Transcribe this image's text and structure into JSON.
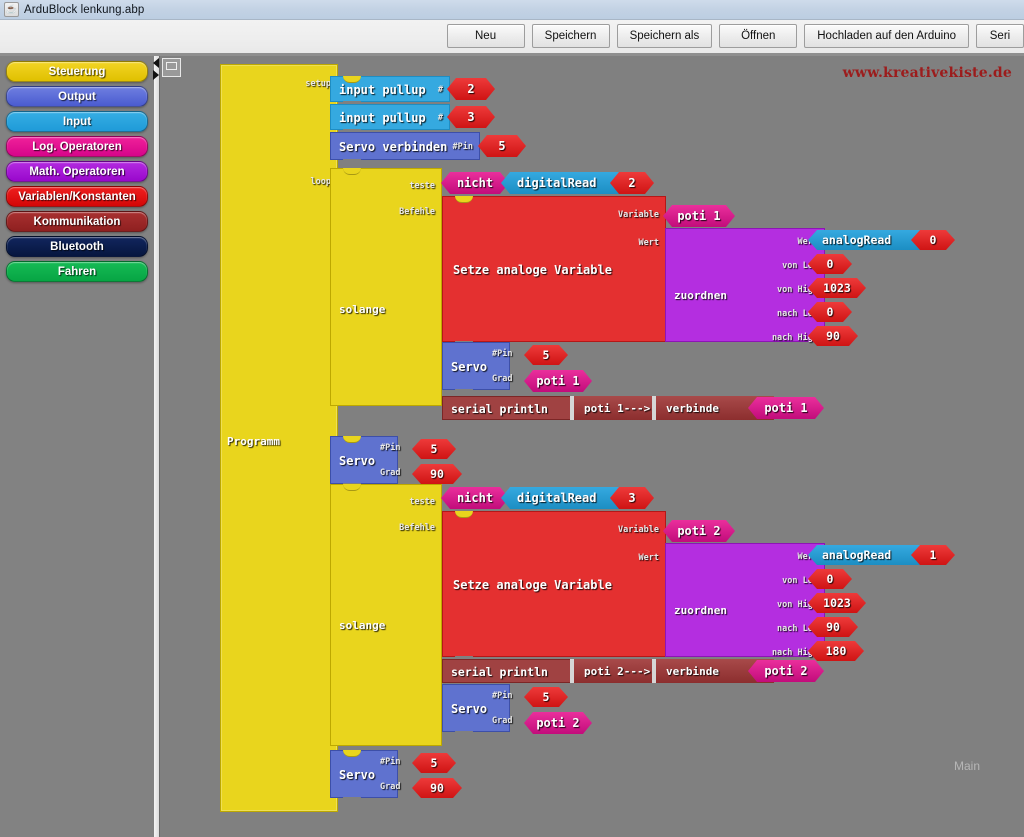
{
  "window": {
    "title": "ArduBlock lenkung.abp",
    "icon": "java-coffee-cup-icon"
  },
  "toolbar": {
    "buttons": [
      {
        "label": "Neu",
        "name": "new-button"
      },
      {
        "label": "Speichern",
        "name": "save-button"
      },
      {
        "label": "Speichern als",
        "name": "save-as-button"
      },
      {
        "label": "Öffnen",
        "name": "open-button"
      },
      {
        "label": "Hochladen auf den Arduino",
        "name": "upload-button"
      },
      {
        "label": "Seri",
        "name": "serial-monitor-button"
      }
    ]
  },
  "palette": {
    "categories": [
      {
        "label": "Steuerung",
        "color": "#e9d51d"
      },
      {
        "label": "Output",
        "color": "#4a5bd0"
      },
      {
        "label": "Input",
        "color": "#1f9bd8"
      },
      {
        "label": "Log. Operatoren",
        "color": "#d6058a"
      },
      {
        "label": "Math. Operatoren",
        "color": "#9908cc"
      },
      {
        "label": "Variablen/Konstanten",
        "color": "#d40606"
      },
      {
        "label": "Kommunikation",
        "color": "#8f2020"
      },
      {
        "label": "Bluetooth",
        "color": "#06163f"
      },
      {
        "label": "Fahren",
        "color": "#07a544"
      }
    ]
  },
  "canvas": {
    "watermark": "www.kreativekiste.de",
    "tab_label": "Main",
    "program": {
      "title": "Programm",
      "setup_label": "setup",
      "loop_label": "loop"
    },
    "setup_blocks": [
      {
        "name": "input-pullup-block",
        "label": "input pullup",
        "arg_label": "#",
        "value": "2"
      },
      {
        "name": "input-pullup-block",
        "label": "input pullup",
        "arg_label": "#",
        "value": "3"
      },
      {
        "name": "servo-attach-block",
        "label": "Servo verbinden",
        "arg_label": "#Pin",
        "value": "5"
      }
    ],
    "loop_blocks": [
      {
        "name": "while-block-1",
        "type": "while",
        "test_label": "teste",
        "body_label": "Befehle",
        "while_label": "solange",
        "condition": {
          "not_label": "nicht",
          "read_label": "digitalRead",
          "arg_label": "#",
          "value": "2"
        },
        "set_variable": {
          "label": "Setze analoge Variable",
          "variable_label": "Variable",
          "variable_value": "poti 1",
          "value_label": "Wert",
          "map": {
            "label": "zuordnen",
            "value_label": "Wert",
            "source": {
              "label": "analogRead",
              "arg_label": "#",
              "value": "0"
            },
            "rows": [
              {
                "label": "von Low",
                "value": "0"
              },
              {
                "label": "von High",
                "value": "1023"
              },
              {
                "label": "nach Low",
                "value": "0"
              },
              {
                "label": "nach High",
                "value": "90"
              }
            ]
          }
        },
        "servo": {
          "label": "Servo",
          "pin_label": "#Pin",
          "pin_value": "5",
          "deg_label": "Grad",
          "deg_value": "poti 1",
          "deg_kind": "variable"
        },
        "serial": {
          "label": "serial println",
          "text": "poti 1--->",
          "join_label": "verbinde",
          "join_value": "poti 1"
        }
      },
      {
        "name": "servo-center-block",
        "type": "servo",
        "label": "Servo",
        "pin_label": "#Pin",
        "pin_value": "5",
        "deg_label": "Grad",
        "deg_value": "90",
        "deg_kind": "number"
      },
      {
        "name": "while-block-2",
        "type": "while",
        "test_label": "teste",
        "body_label": "Befehle",
        "while_label": "solange",
        "condition": {
          "not_label": "nicht",
          "read_label": "digitalRead",
          "arg_label": "#",
          "value": "3"
        },
        "set_variable": {
          "label": "Setze analoge Variable",
          "variable_label": "Variable",
          "variable_value": "poti 2",
          "value_label": "Wert",
          "map": {
            "label": "zuordnen",
            "value_label": "Wert",
            "source": {
              "label": "analogRead",
              "arg_label": "#",
              "value": "1"
            },
            "rows": [
              {
                "label": "von Low",
                "value": "0"
              },
              {
                "label": "von High",
                "value": "1023"
              },
              {
                "label": "nach Low",
                "value": "90"
              },
              {
                "label": "nach High",
                "value": "180"
              }
            ]
          }
        },
        "serial": {
          "label": "serial println",
          "text": "poti 2--->",
          "join_label": "verbinde",
          "join_value": "poti 2"
        },
        "servo": {
          "label": "Servo",
          "pin_label": "#Pin",
          "pin_value": "5",
          "deg_label": "Grad",
          "deg_value": "poti 2",
          "deg_kind": "variable"
        }
      },
      {
        "name": "servo-center-block-2",
        "type": "servo",
        "label": "Servo",
        "pin_label": "#Pin",
        "pin_value": "5",
        "deg_label": "Grad",
        "deg_value": "90",
        "deg_kind": "number"
      }
    ]
  }
}
